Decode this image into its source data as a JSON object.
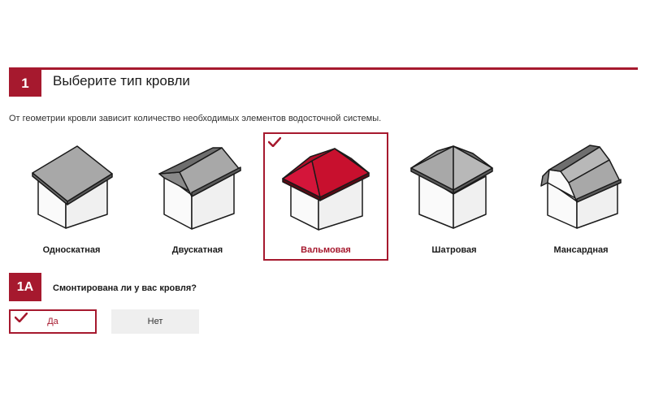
{
  "step1": {
    "number": "1",
    "title": "Выберите тип кровли",
    "description": "От геометрии кровли зависит количество необходимых элементов водосточной системы."
  },
  "roof_types": [
    {
      "label": "Односкатная",
      "icon": "shed-roof-icon",
      "selected": false
    },
    {
      "label": "Двускатная",
      "icon": "gable-roof-icon",
      "selected": false
    },
    {
      "label": "Вальмовая",
      "icon": "hip-roof-icon",
      "selected": true
    },
    {
      "label": "Шатровая",
      "icon": "pyramid-roof-icon",
      "selected": false
    },
    {
      "label": "Мансардная",
      "icon": "mansard-roof-icon",
      "selected": false
    }
  ],
  "step1a": {
    "number": "1A",
    "question": "Смонтирована ли у вас кровля?",
    "answers": [
      {
        "label": "Да",
        "selected": true
      },
      {
        "label": "Нет",
        "selected": false
      }
    ]
  },
  "colors": {
    "accent": "#a6192e",
    "selected_roof": "#c8102e",
    "roof_gray": "#a8a8a8",
    "roof_dark": "#6e6e6e",
    "wall": "#f2f2f2",
    "button_gray": "#efefef"
  }
}
